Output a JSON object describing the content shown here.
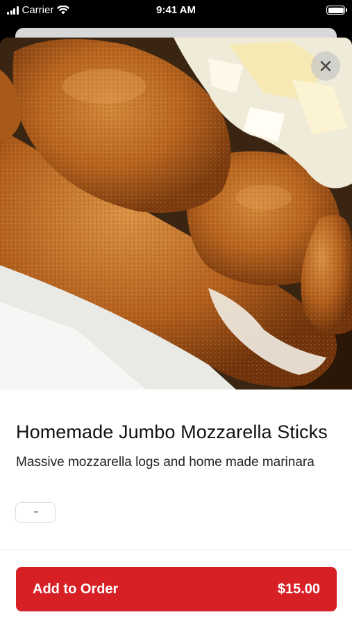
{
  "status_bar": {
    "carrier": "Carrier",
    "time": "9:41 AM"
  },
  "item": {
    "title": "Homemade Jumbo Mozzarella Sticks",
    "description": "Massive mozzarella logs and home made marinara"
  },
  "footer": {
    "add_label": "Add to Order",
    "price": "$15.00"
  },
  "icons": {
    "close": "close-icon",
    "wifi": "wifi-icon",
    "signal": "signal-icon",
    "battery": "battery-icon"
  },
  "colors": {
    "accent": "#d71f26"
  }
}
